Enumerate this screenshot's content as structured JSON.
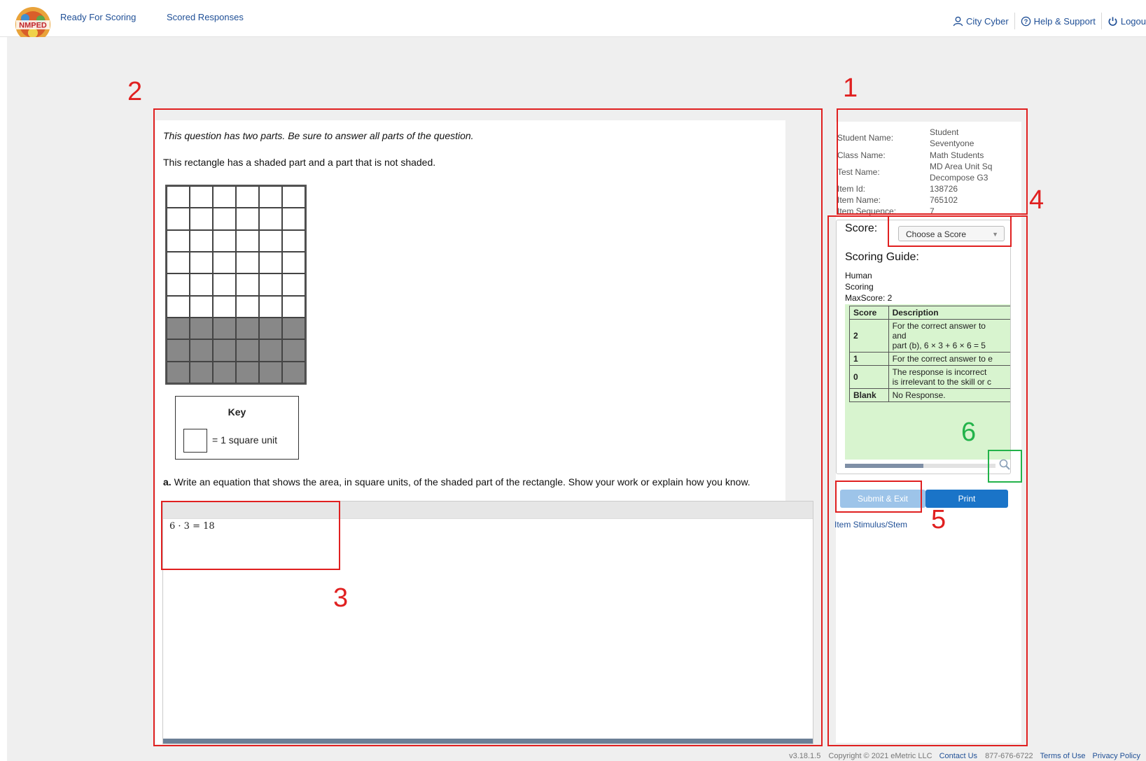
{
  "nav": {
    "logo_text": "NMPED",
    "items": [
      {
        "label": "Ready For Scoring"
      },
      {
        "label": "Scored Responses"
      }
    ],
    "user": "City Cyber",
    "help": "Help & Support",
    "logout": "Logou"
  },
  "question": {
    "instructions": "This question has two parts. Be sure to answer all parts of the question.",
    "prompt": "This rectangle has a shaded part and a part that is not shaded.",
    "figure": {
      "columns": 6,
      "rows": 9,
      "shaded_rows": 3
    },
    "key": {
      "title": "Key",
      "label": "= 1 square unit"
    },
    "part_a_bold": "a.",
    "part_a_text": " Write an equation that shows the area, in square units, of the shaded part of the rectangle. Show your work or explain how you know."
  },
  "response": {
    "text": "6 · 3 = 18"
  },
  "student_info": [
    {
      "label": "Student Name:",
      "value": "Student Seventyone"
    },
    {
      "label": "Class Name:",
      "value": "Math Students"
    },
    {
      "label": "Test Name:",
      "value": "MD Area Unit Sq Decompose G3"
    },
    {
      "label": "Item Id:",
      "value": "138726"
    },
    {
      "label": "Item Name:",
      "value": "765102"
    },
    {
      "label": "Item Sequence:",
      "value": "7"
    }
  ],
  "scoring": {
    "score_label": "Score:",
    "select_placeholder": "Choose a Score",
    "guide_title": "Scoring Guide:",
    "meta": [
      "Human",
      "Scoring",
      "MaxScore: 2"
    ],
    "table_headers": [
      "Score",
      "Description"
    ],
    "rows": [
      {
        "score": "2",
        "lines": [
          "For the correct answer to",
          "and",
          "part (b), 6 × 3 + 6 × 6 = 5"
        ]
      },
      {
        "score": "1",
        "lines": [
          "For the correct answer to e"
        ]
      },
      {
        "score": "0",
        "lines": [
          "The response is incorrect",
          "is irrelevant to the skill or c"
        ]
      },
      {
        "score": "Blank",
        "lines": [
          "No Response."
        ]
      }
    ]
  },
  "buttons": {
    "submit": "Submit & Exit",
    "print": "Print",
    "stem_link": "Item Stimulus/Stem"
  },
  "footer": {
    "version": "v3.18.1.5",
    "copyright": "Copyright © 2021 eMetric LLC",
    "contact": "Contact Us",
    "phone": "877-676-6722",
    "terms": "Terms of Use",
    "privacy": "Privacy Policy"
  },
  "annotations": [
    {
      "number": "1",
      "color": "#e02020"
    },
    {
      "number": "2",
      "color": "#e02020"
    },
    {
      "number": "3",
      "color": "#e02020"
    },
    {
      "number": "4",
      "color": "#e02020"
    },
    {
      "number": "5",
      "color": "#e02020"
    },
    {
      "number": "6",
      "color": "#22b34a"
    }
  ],
  "colors": {
    "accent": "#1a74c8",
    "link": "#1f4f96",
    "guide_bg": "#d8f4cf"
  }
}
